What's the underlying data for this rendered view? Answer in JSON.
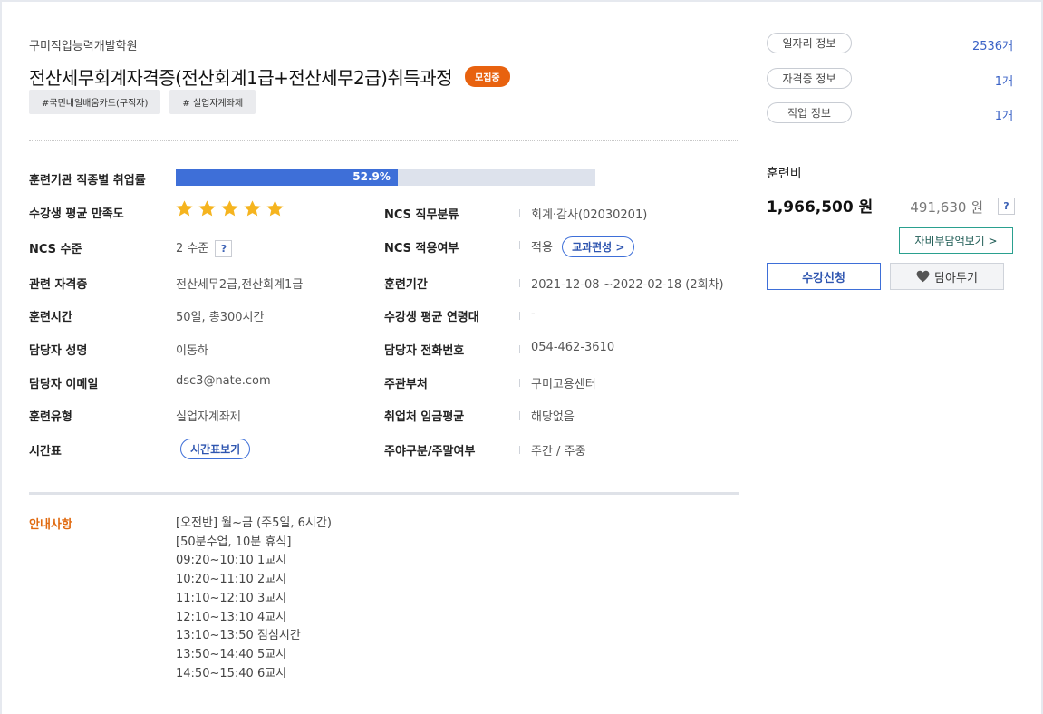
{
  "institute": "구미직업능력개발학원",
  "course_title": "전산세무회계자격증(전산회계1급+전산세무2급)취득과정",
  "status_badge": "모집중",
  "tags": [
    "#국민내일배움카드(구직자)",
    "# 실업자계좌제"
  ],
  "details": {
    "employment_rate_label": "훈련기관 직종별 취업률",
    "employment_rate_text": "52.9%",
    "employment_rate_value": 0.529,
    "satisfaction_label": "수강생 평균 만족도",
    "satisfaction_stars": 5,
    "satisfaction_star_color": "#f5b41f",
    "ncs_job_label": "NCS 직무분류",
    "ncs_job_value": "회계·감사(02030201)",
    "ncs_level_label": "NCS 수준",
    "ncs_level_value": "2 수준",
    "ncs_apply_label": "NCS 적용여부",
    "ncs_apply_value": "적용",
    "curriculum_button": "교과편성 >",
    "cert_label": "관련 자격증",
    "cert_value": "전산세무2급,전산회계1급",
    "period_label": "훈련기간",
    "period_value": "2021-12-08 ~2022-02-18 (2회차)",
    "hours_label": "훈련시간",
    "hours_value": "50일, 총300시간",
    "age_label": "수강생 평균 연령대",
    "age_value": "-",
    "manager_label": "담당자 성명",
    "manager_value": "이동하",
    "phone_label": "담당자 전화번호",
    "phone_value": "054-462-3610",
    "email_label": "담당자 이메일",
    "email_value": "dsc3@nate.com",
    "agency_label": "주관부처",
    "agency_value": "구미고용센터",
    "type_label": "훈련유형",
    "type_value": "실업자계좌제",
    "wage_label": "취업처 임금평균",
    "wage_value": "해당없음",
    "timetable_label": "시간표",
    "timetable_button": "시간표보기",
    "daynight_label": "주야구분/주말여부",
    "daynight_value": "주간 / 주중",
    "help_mark": "?"
  },
  "notice": {
    "label": "안내사항",
    "lines": [
      "[오전반] 월~금 (주5일, 6시간)",
      "[50분수업, 10분 휴식]",
      "09:20~10:10 1교시",
      "10:20~11:10 2교시",
      "11:10~12:10 3교시",
      "12:10~13:10 4교시",
      "13:10~13:50 점심시간",
      "13:50~14:40 5교시",
      "14:50~15:40 6교시"
    ]
  },
  "side": {
    "info": [
      {
        "label": "일자리 정보",
        "count": "2536개"
      },
      {
        "label": "자격증 정보",
        "count": "1개"
      },
      {
        "label": "직업 정보",
        "count": "1개"
      }
    ],
    "fee_label": "훈련비",
    "fee_total": "1,966,500 원",
    "fee_self": "491,630 원",
    "selfpay_button": "자비부담액보기 >",
    "apply_button": "수강신청",
    "wish_button": "담아두기"
  }
}
